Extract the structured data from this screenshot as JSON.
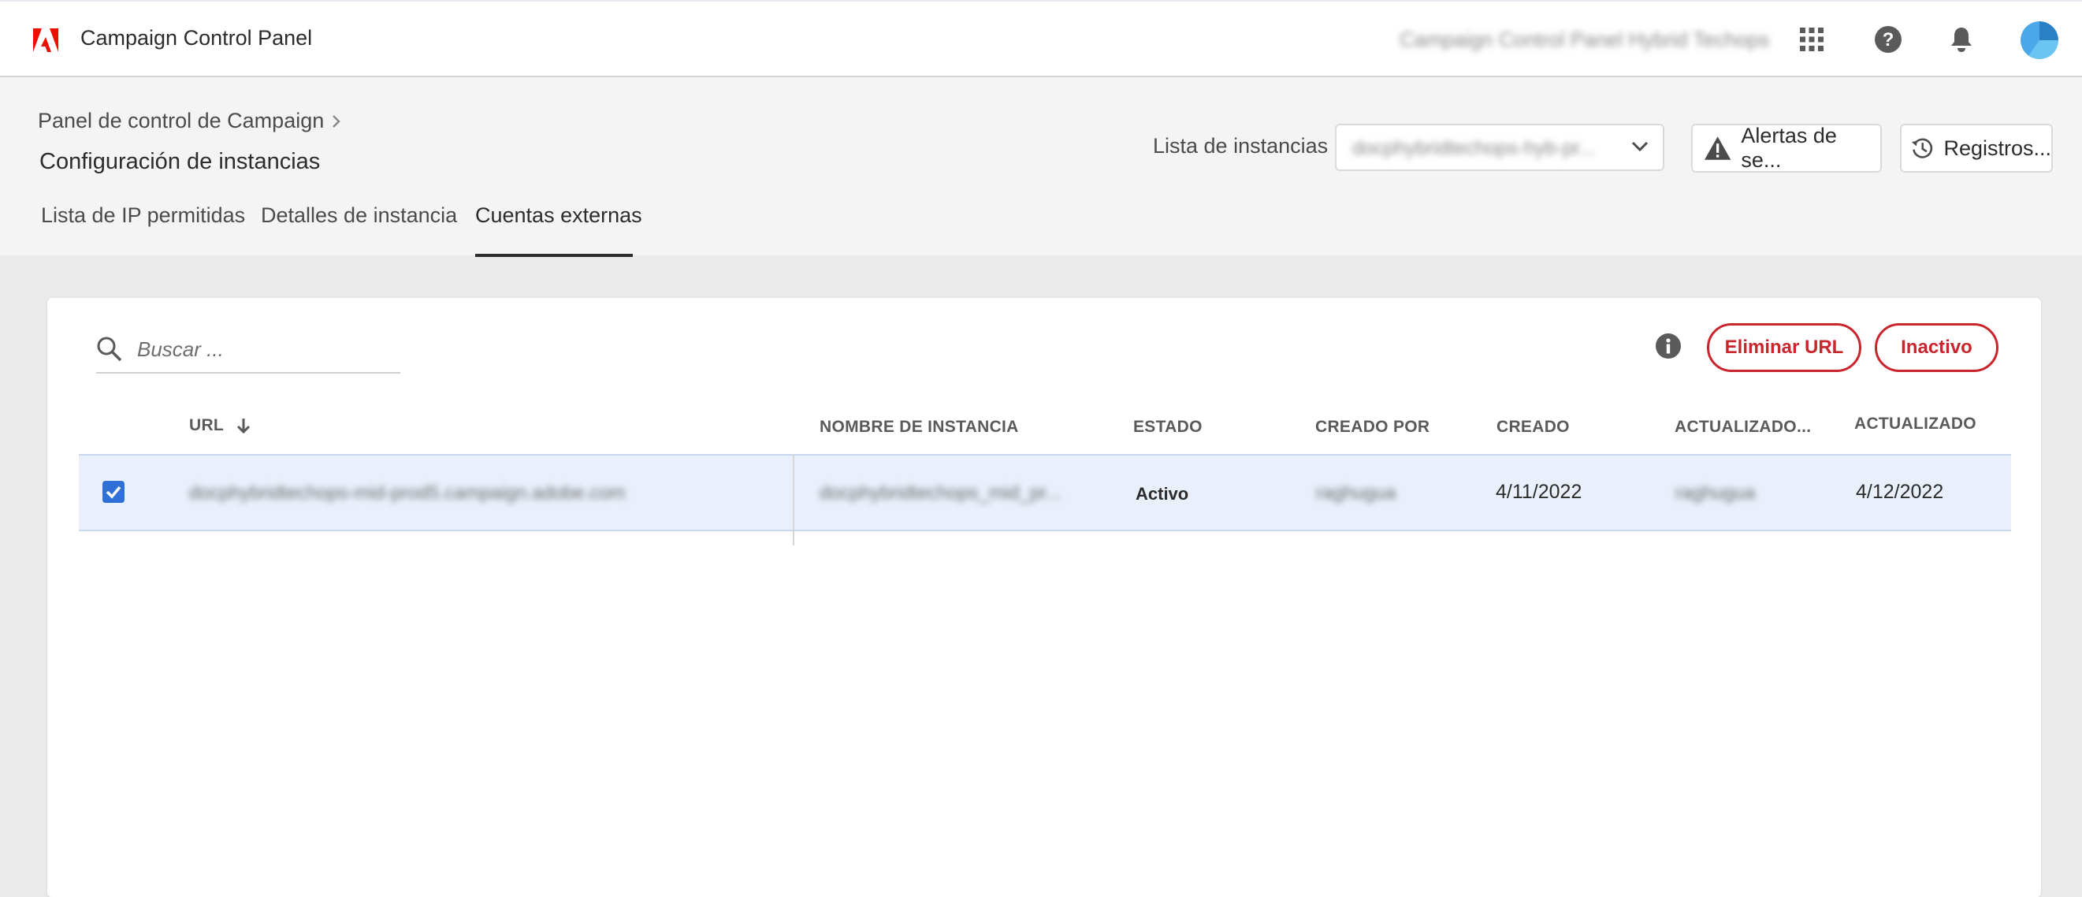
{
  "topbar": {
    "app_title": "Campaign Control Panel",
    "org_name": "Campaign Control Panel Hybrid Techops",
    "icons": [
      "apps-grid-icon",
      "help-icon",
      "bell-icon",
      "avatar"
    ]
  },
  "header": {
    "breadcrumb": "Panel de control de Campaign",
    "page_title": "Configuración de instancias",
    "instance_label": "Lista de instancias",
    "instance_value": "docphybridtechops-hyb-pr...",
    "alerts_button": "Alertas de se...",
    "logs_button": "Registros..."
  },
  "tabs": [
    {
      "label": "Lista de IP permitidas",
      "active": false
    },
    {
      "label": "Detalles de instancia",
      "active": false
    },
    {
      "label": "Cuentas externas",
      "active": true
    }
  ],
  "toolbar": {
    "search_placeholder": "Buscar ...",
    "delete_button": "Eliminar URL",
    "inactive_button": "Inactivo"
  },
  "table": {
    "columns": [
      "URL",
      "NOMBRE DE INSTANCIA",
      "ESTADO",
      "CREADO POR",
      "CREADO",
      "ACTUALIZADO...",
      "ACTUALIZADO"
    ],
    "sorted_column": "URL",
    "rows": [
      {
        "selected": true,
        "url": "docphybridtechops-mid-prod5.campaign.adobe.com",
        "instance_name": "docphybridtechops_mid_pr...",
        "status": "Activo",
        "created_by": "raghugua",
        "created": "4/11/2022",
        "updated_by": "raghugua",
        "updated": "4/12/2022"
      }
    ]
  },
  "colors": {
    "accent_red": "#c9252c",
    "adobe_red": "#eb1000",
    "checkbox_blue": "#2f6fd8",
    "selected_row": "#e9f0fb"
  }
}
